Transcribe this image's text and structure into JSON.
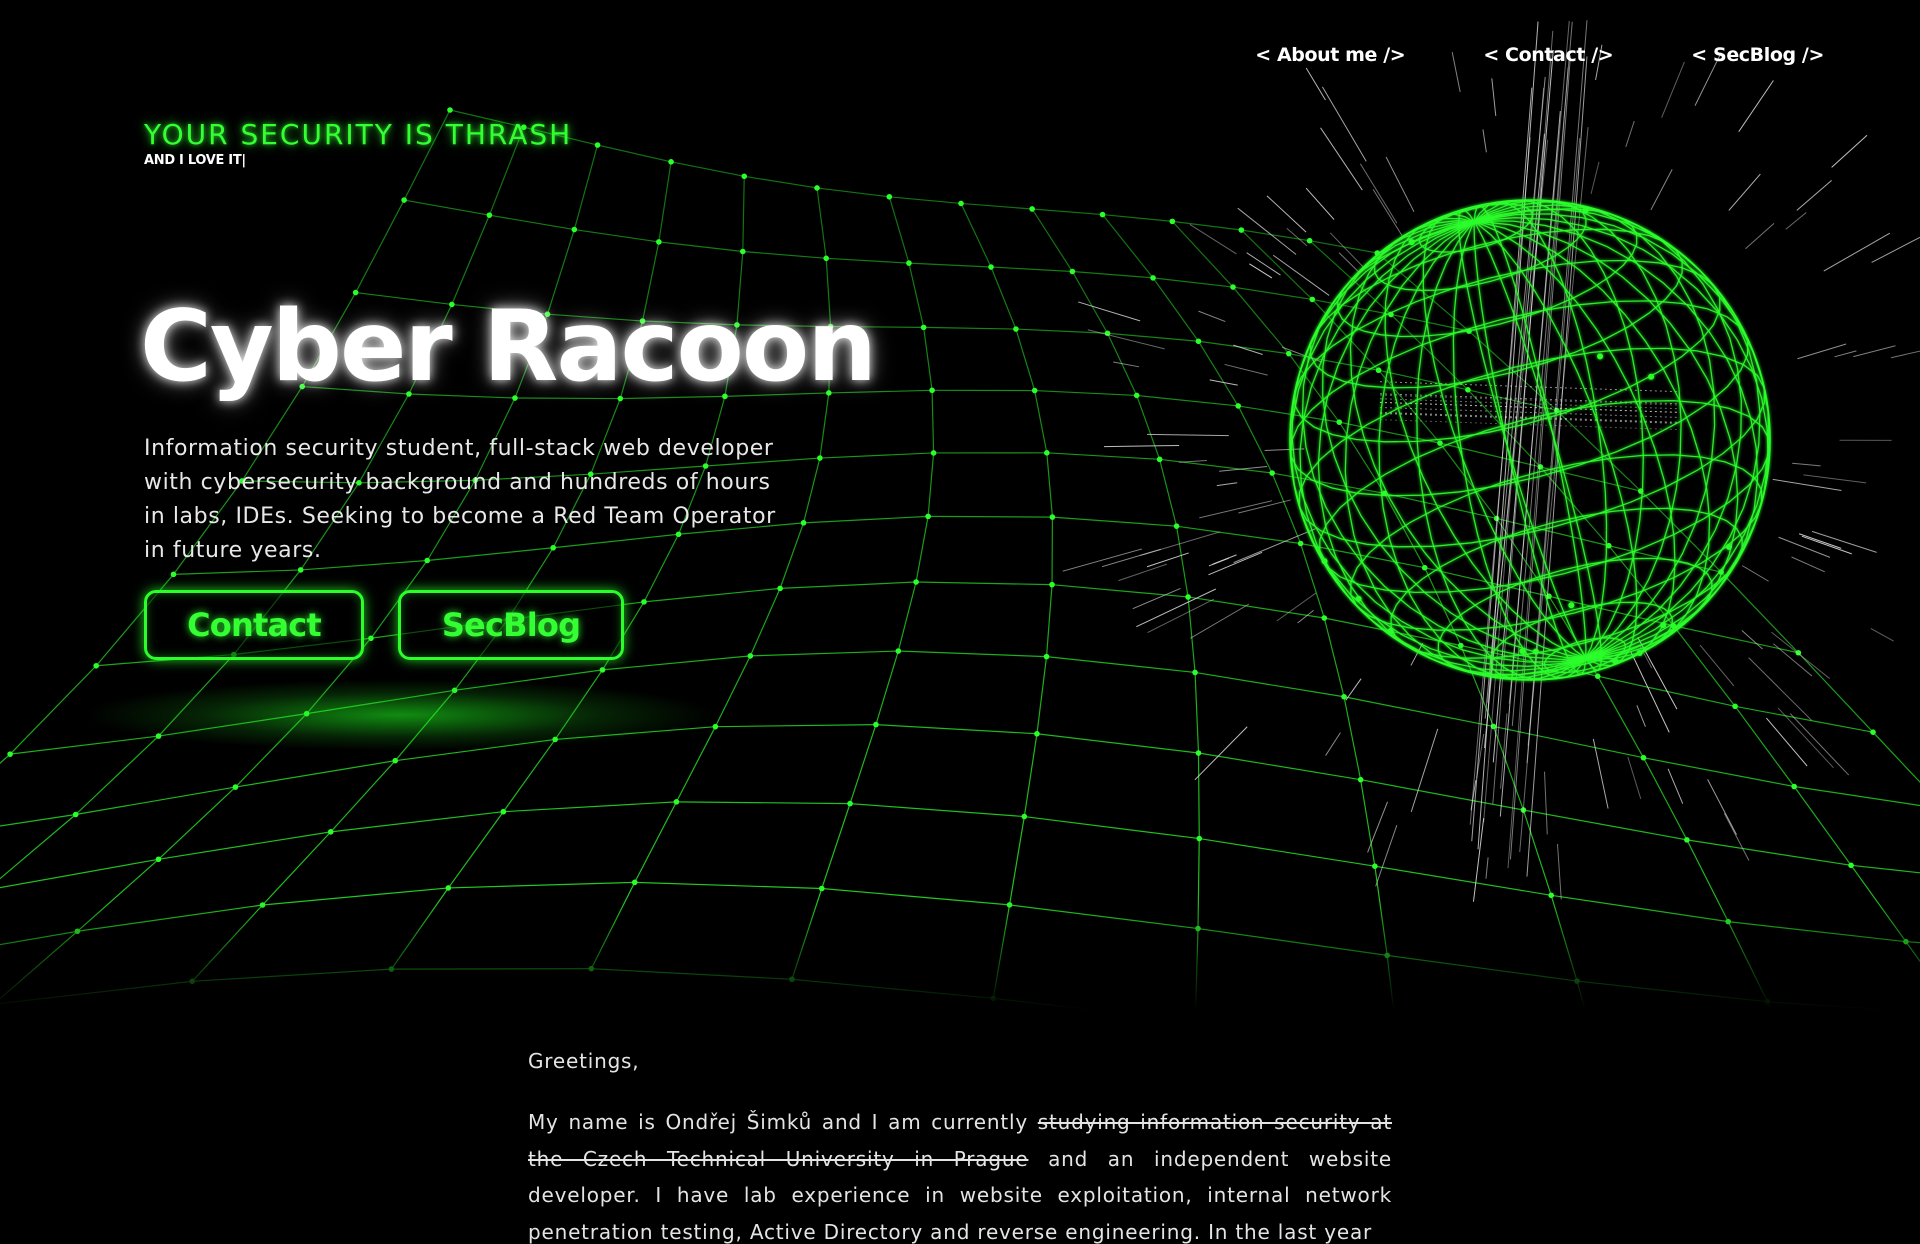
{
  "nav": {
    "about": "< About me />",
    "contact": "< Contact />",
    "secblog": "< SecBlog />"
  },
  "tagline": {
    "main": "YOUR SECURITY IS THRASH",
    "sub": "AND I LOVE IT|"
  },
  "hero": {
    "title": "Cyber Racoon",
    "description": "Information security student, full-stack web developer with cybersecurity background and hundreds of hours in labs, IDEs. Seeking to become a Red Team Operator in future years.",
    "buttons": {
      "contact": "Contact",
      "secblog": "SecBlog"
    }
  },
  "about": {
    "greeting": "Greetings,",
    "intro": "My name is Ondřej Šimků and I am currently",
    "struck": "studying information security at the Czech Technical University in Prague",
    "rest": "and an independent website developer. I have lab experience in website exploitation, internal network penetration testing, Active Directory and reverse engineering. In the last year"
  },
  "colors": {
    "background": "#000000",
    "neon_green": "#33ff33",
    "text": "#e6e6e6"
  },
  "icons": {
    "grid": "wireframe-terrain-grid",
    "sphere": "wireframe-globe"
  }
}
